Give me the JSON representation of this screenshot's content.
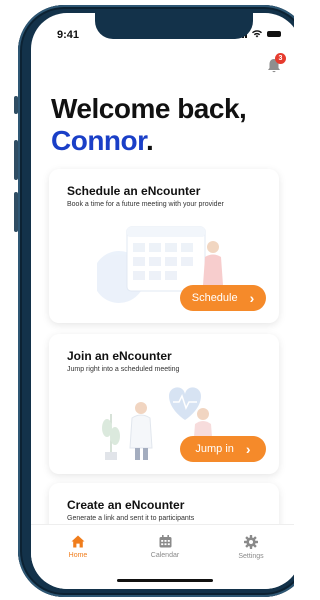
{
  "status_bar": {
    "time": "9:41"
  },
  "notifications": {
    "count": "3"
  },
  "welcome": {
    "line1": "Welcome back,",
    "name": "Connor",
    "period": "."
  },
  "cards": [
    {
      "title": "Schedule an eNcounter",
      "description": "Book a time for a future meeting with your provider",
      "button_label": "Schedule"
    },
    {
      "title": "Join an eNcounter",
      "description": "Jump right into a scheduled meeting",
      "button_label": "Jump in"
    },
    {
      "title": "Create an eNcounter",
      "description": "Generate a link and sent it to participants"
    }
  ],
  "tabs": [
    {
      "label": "Home",
      "icon": "home-icon",
      "active": true
    },
    {
      "label": "Calendar",
      "icon": "calendar-icon",
      "active": false
    },
    {
      "label": "Settings",
      "icon": "gear-icon",
      "active": false
    }
  ],
  "colors": {
    "accent": "#f58a2a",
    "name_blue": "#1a3fc7",
    "frame": "#13324a",
    "badge": "#e63b2e"
  }
}
